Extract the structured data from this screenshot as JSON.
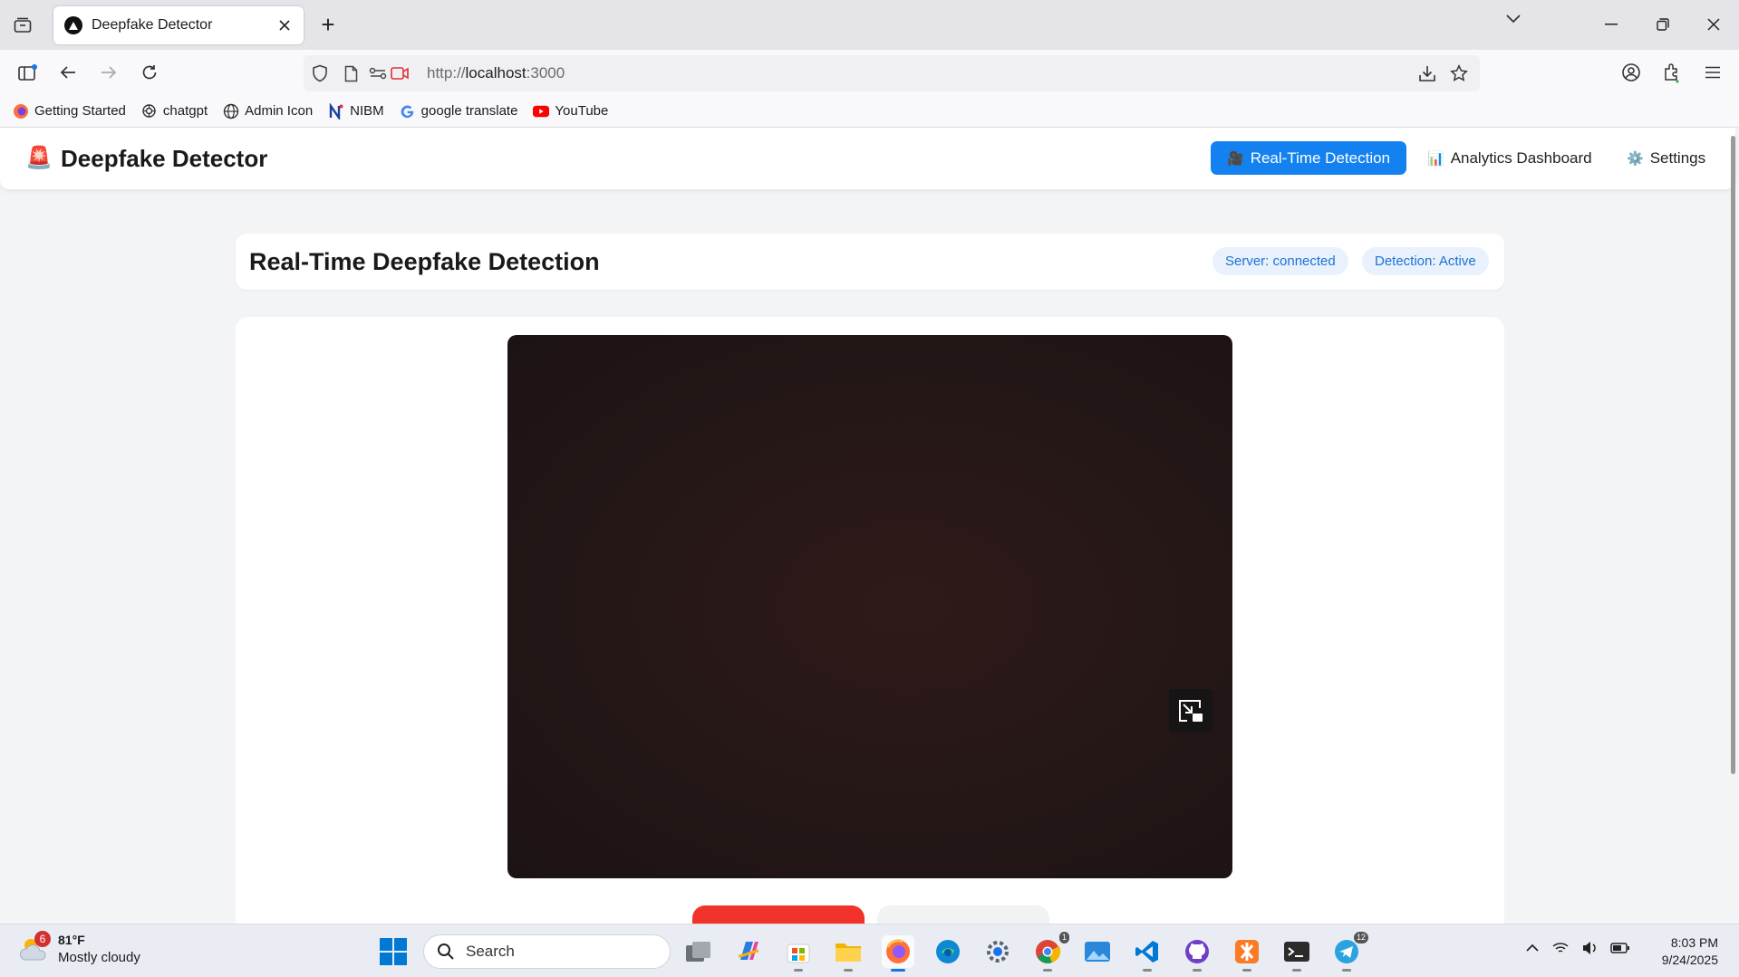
{
  "browser": {
    "tab_title": "Deepfake Detector",
    "new_tab_label": "+",
    "url_scheme": "http://",
    "url_host": "localhost",
    "url_port": ":3000",
    "bookmarks": [
      {
        "label": "Getting Started",
        "icon": "firefox-icon"
      },
      {
        "label": "chatgpt",
        "icon": "openai-icon"
      },
      {
        "label": "Admin Icon",
        "icon": "globe-icon"
      },
      {
        "label": "NIBM",
        "icon": "nibm-icon"
      },
      {
        "label": "google translate",
        "icon": "google-icon"
      },
      {
        "label": "YouTube",
        "icon": "youtube-icon"
      }
    ]
  },
  "app": {
    "logo_emoji": "🚨",
    "title": "Deepfake Detector",
    "nav": [
      {
        "icon": "🎥",
        "label": "Real-Time Detection",
        "active": true
      },
      {
        "icon": "📊",
        "label": "Analytics Dashboard",
        "active": false
      },
      {
        "icon": "⚙️",
        "label": "Settings",
        "active": false
      }
    ],
    "page_title": "Real-Time Deepfake Detection",
    "badges": {
      "server": "Server: connected",
      "detection": "Detection: Active"
    },
    "colors": {
      "accent": "#1481f0",
      "stop_button": "#f2332b",
      "badge_text": "#1d72d8"
    }
  },
  "taskbar": {
    "weather_badge": "6",
    "weather_temp": "81°F",
    "weather_desc": "Mostly cloudy",
    "search_placeholder": "Search",
    "telegram_count": "12",
    "chrome_count": "1",
    "clock_time": "8:03 PM",
    "clock_date": "9/24/2025"
  }
}
